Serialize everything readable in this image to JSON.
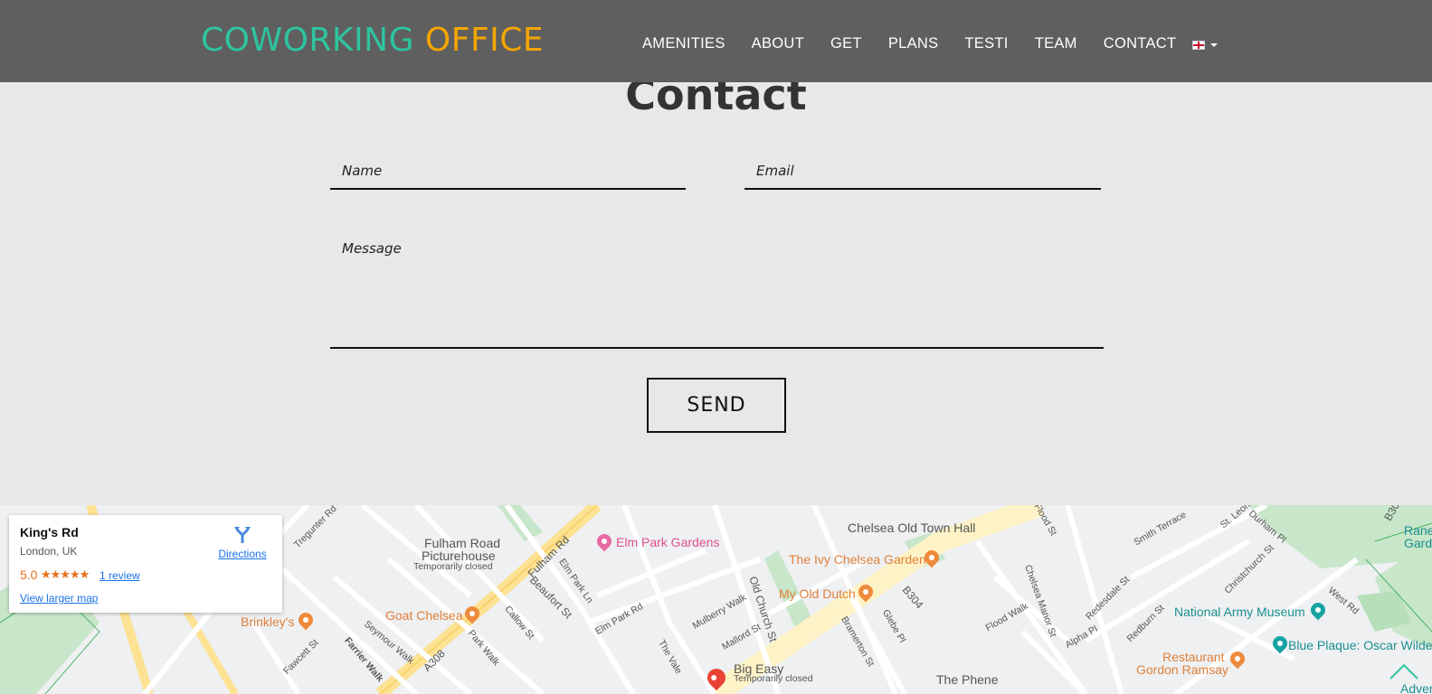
{
  "header": {
    "logo_part1": "COWORKING",
    "logo_part2": "OFFICE",
    "nav": [
      "AMENITIES",
      "ABOUT",
      "GET",
      "PLANS",
      "TESTI",
      "TEAM",
      "CONTACT"
    ],
    "language_icon": "uk-flag-icon"
  },
  "contact": {
    "title": "Contact",
    "name_placeholder": "Name",
    "email_placeholder": "Email",
    "message_placeholder": "Message",
    "send_label": "SEND"
  },
  "map": {
    "card": {
      "place": "King's Rd",
      "address": "London, UK",
      "rating": "5.0",
      "stars": "★★★★★",
      "reviews": "1 review",
      "directions": "Directions",
      "larger_map": "View larger map"
    },
    "labels": {
      "chelsea_old_town_hall": "Chelsea Old Town Hall",
      "elm_park_gardens": "Elm Park Gardens",
      "fulham_road_picturehouse_1": "Fulham Road",
      "fulham_road_picturehouse_2": "Picturehouse",
      "temporarily_closed": "Temporarily closed",
      "ivy": "The Ivy Chelsea Garden",
      "my_old_dutch": "My Old Dutch",
      "goat_chelsea": "Goat Chelsea",
      "brinkleys": "Brinkley's",
      "national_army_museum": "National Army Museum",
      "restaurant_gordon_ramsay_1": "Restaurant",
      "restaurant_gordon_ramsay_2": "Gordon Ramsay",
      "blue_plaque": "Blue Plaque: Oscar Wilde",
      "big_easy": "Big Easy",
      "big_easy_status": "Temporarily closed",
      "the_phene": "The Phene",
      "ranelagh_1": "Ranel",
      "ranelagh_2": "Gard",
      "adventure": "Adventu",
      "fulham_rd": "Fulham Rd",
      "beaufort_st": "Beaufort St",
      "old_church_st": "Old Church St",
      "a308": "A308",
      "b304": "B304",
      "b30": "B30",
      "elm_park_ln": "Elm Park Ln",
      "elm_park_rd": "Elm Park Rd",
      "mulberry_walk": "Mulberry Walk",
      "mallord_st": "Mallord St",
      "the_vale": "The Vale",
      "callow_st": "Callow St",
      "park_walk": "Park Walk",
      "seymour_walk": "Seymour Walk",
      "farrier_walk": "Farrier Walk",
      "fawcett_st": "Fawcett St",
      "flood_walk": "Flood Walk",
      "flood_st": "Flood St",
      "chelsea_manor_st": "Chelsea Manor St",
      "glebe_pl": "Glebe Pl",
      "bramerton_st": "Bramerton St",
      "alpha_pl": "Alpha Pl",
      "redesdale_st": "Redesdale St",
      "redburn_st": "Redburn St",
      "smith_terrace": "Smith Terrace",
      "christchurch_st": "Christchurch St",
      "west_rd": "West Rd",
      "durham_pl": "Durham Pl",
      "st_leonards": "St. Leon",
      "tregunter_rd": "Tregunter Rd"
    }
  }
}
